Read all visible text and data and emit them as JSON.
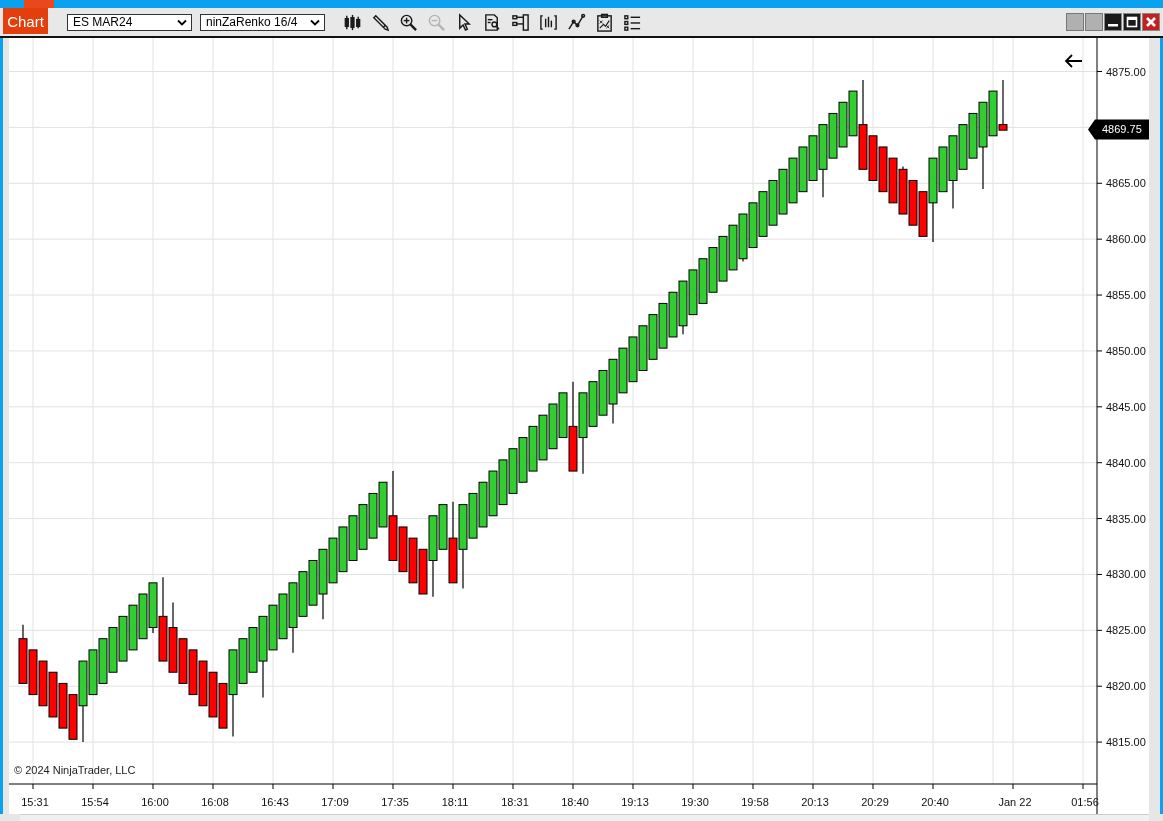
{
  "window": {
    "tab": "Chart",
    "buttons": [
      {
        "kind": "blank"
      },
      {
        "kind": "blank"
      },
      {
        "kind": "minimize"
      },
      {
        "kind": "maximize"
      },
      {
        "kind": "close"
      }
    ]
  },
  "toolbar": {
    "instrument": "ES MAR24",
    "bar_type": "ninZaRenko 16/4",
    "tools": [
      {
        "kind": "bars",
        "disabled": false
      },
      {
        "kind": "pencil",
        "disabled": false
      },
      {
        "kind": "zoom-in",
        "disabled": false
      },
      {
        "kind": "zoom-out",
        "disabled": true
      },
      {
        "kind": "pointer",
        "disabled": false
      },
      {
        "kind": "data-box",
        "disabled": false
      },
      {
        "kind": "panel",
        "disabled": false
      },
      {
        "kind": "indicators",
        "disabled": false
      },
      {
        "kind": "line",
        "disabled": false
      },
      {
        "kind": "clipboard",
        "disabled": false
      },
      {
        "kind": "list",
        "disabled": false
      }
    ]
  },
  "chart": {
    "current_price": "4869.75",
    "copyright": "© 2024 NinjaTrader, LLC",
    "price_labels": [
      "4875.00",
      "4865.00",
      "4860.00",
      "4855.00",
      "4850.00",
      "4845.00",
      "4840.00",
      "4835.00",
      "4830.00",
      "4825.00",
      "4820.00",
      "4815.00"
    ],
    "time_labels": [
      "15:31",
      "15:54",
      "16:00",
      "16:08",
      "16:43",
      "17:09",
      "17:35",
      "18:11",
      "18:31",
      "18:40",
      "19:13",
      "19:30",
      "19:58",
      "20:13",
      "20:29",
      "20:40",
      "Jan 22",
      "01:56"
    ]
  }
}
